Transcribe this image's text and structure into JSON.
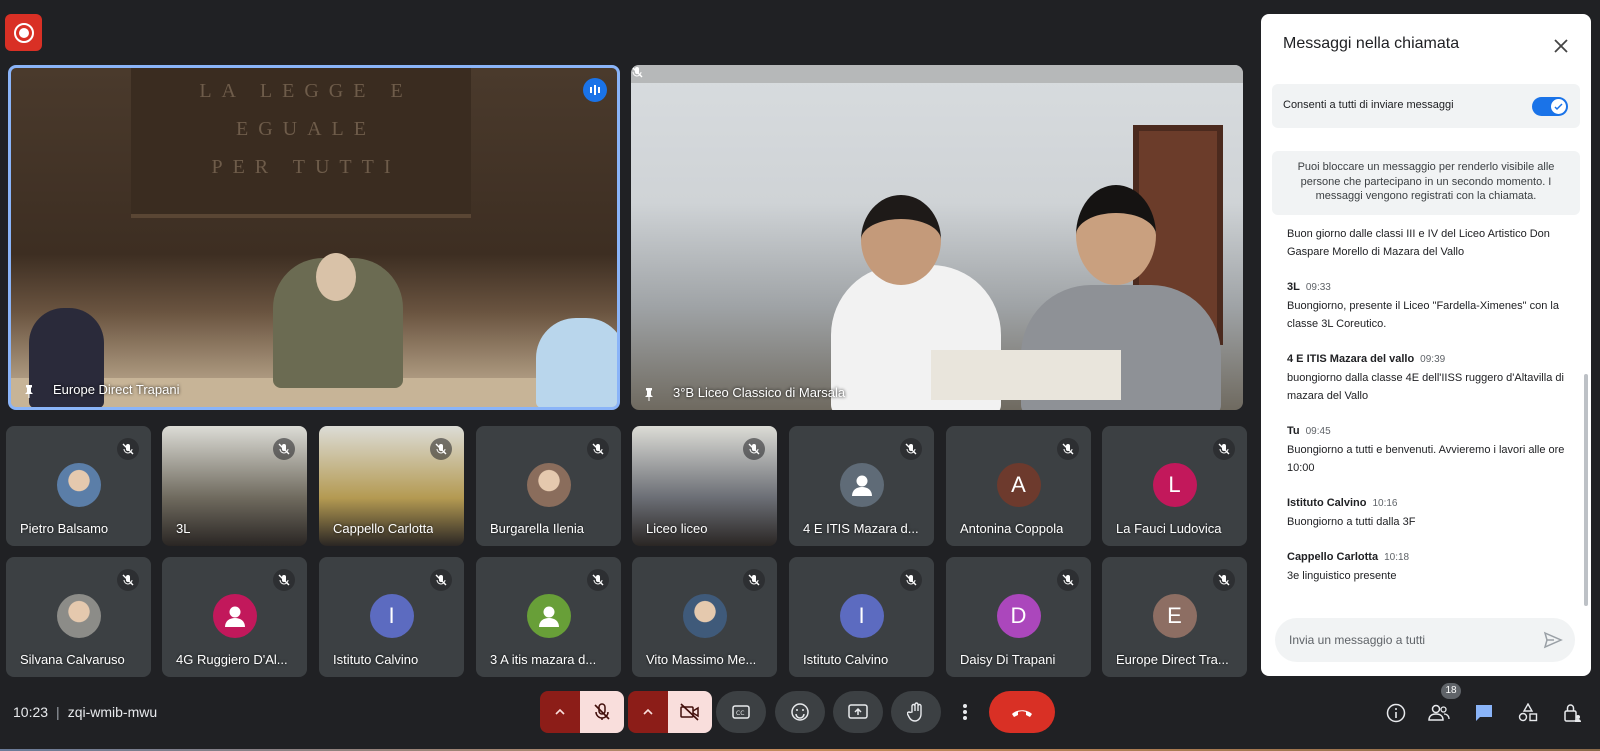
{
  "call": {
    "time": "10:23",
    "separator": "|",
    "meeting_code": "zqi-wmib-mwu",
    "participant_count": "18"
  },
  "main_tiles": [
    {
      "name": "Europe Direct Trapani",
      "wall_text": "LA LEGGE E\nEGUALE\nPER TUTTI"
    },
    {
      "name": "3°B Liceo Classico di Marsala"
    }
  ],
  "tiles": [
    {
      "name": "Pietro Balsamo",
      "avatar": "photo",
      "color": "#5b7ea8"
    },
    {
      "name": "3L",
      "avatar": "video",
      "color": "#6f6a5e"
    },
    {
      "name": "Cappello Carlotta",
      "avatar": "video",
      "color": "#b49a52"
    },
    {
      "name": "Burgarella Ilenia",
      "avatar": "photo",
      "color": "#8a6d5c"
    },
    {
      "name": "Liceo liceo",
      "avatar": "video",
      "color": "#6b6e75"
    },
    {
      "name": "4 E ITIS Mazara d...",
      "avatar": "default",
      "color": "#5f6b77"
    },
    {
      "name": "Antonina Coppola",
      "avatar": "letter",
      "letter": "A",
      "color": "#6d3a2d"
    },
    {
      "name": "La Fauci Ludovica",
      "avatar": "letter",
      "letter": "L",
      "color": "#c2185b"
    },
    {
      "name": "Silvana Calvaruso",
      "avatar": "photo",
      "color": "#8c8c88"
    },
    {
      "name": "4G Ruggiero D'Al...",
      "avatar": "default",
      "color": "#c2185b"
    },
    {
      "name": "Istituto Calvino",
      "avatar": "letter",
      "letter": "I",
      "color": "#5c6bc0"
    },
    {
      "name": "3 A itis mazara d...",
      "avatar": "default",
      "color": "#689f38"
    },
    {
      "name": "Vito Massimo Me...",
      "avatar": "photo",
      "color": "#3f5a7a"
    },
    {
      "name": "Istituto Calvino",
      "avatar": "letter",
      "letter": "I",
      "color": "#5c6bc0"
    },
    {
      "name": "Daisy Di Trapani",
      "avatar": "letter",
      "letter": "D",
      "color": "#ab47bc"
    },
    {
      "name": "Europe Direct Tra...",
      "avatar": "letter",
      "letter": "E",
      "color": "#8d6e63"
    }
  ],
  "chat": {
    "title": "Messaggi nella chiamata",
    "toggle_label": "Consenti a tutti di inviare messaggi",
    "toggle_on": true,
    "info": "Puoi bloccare un messaggio per renderlo visibile alle persone che partecipano in un secondo momento. I messaggi vengono registrati con la chiamata.",
    "messages": [
      {
        "sender": "",
        "time": "",
        "text": "Buon giorno dalle classi III e IV del Liceo Artistico Don Gaspare Morello di Mazara del Vallo"
      },
      {
        "sender": "3L",
        "time": "09:33",
        "text": "Buongiorno, presente il Liceo \"Fardella-Ximenes\" con la classe 3L Coreutico."
      },
      {
        "sender": "4 E ITIS Mazara del vallo",
        "time": "09:39",
        "text": "buongiorno dalla classe 4E dell'IISS ruggero d'Altavilla di mazara del Vallo"
      },
      {
        "sender": "Tu",
        "time": "09:45",
        "text": "Buongiorno a tutti e benvenuti. Avvieremo i lavori alle ore 10:00"
      },
      {
        "sender": "Istituto Calvino",
        "time": "10:16",
        "text": "Buongiorno a tutti dalla 3F"
      },
      {
        "sender": "Cappello Carlotta",
        "time": "10:18",
        "text": "3e linguistico presente"
      }
    ],
    "input_placeholder": "Invia un messaggio a tutti"
  },
  "colors": {
    "background": "#202124",
    "tile": "#3c4043",
    "accent": "#1a73e8",
    "end_call": "#d93025",
    "muted_bg": "#f9dedc"
  }
}
